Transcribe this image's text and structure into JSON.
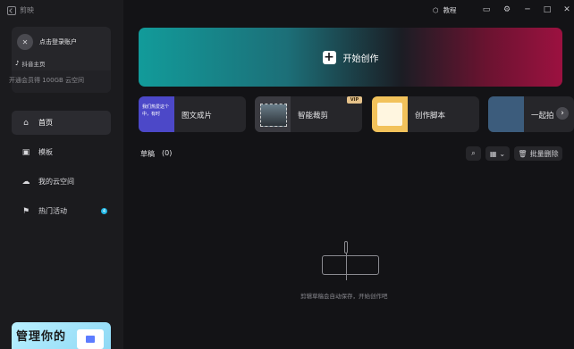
{
  "app": {
    "name": "剪映"
  },
  "account": {
    "avatar_glyph": "✕",
    "login_prompt": "点击登录账户",
    "douyin_label": "抖音主页",
    "member_promo": "开通会员得 100GB 云空间"
  },
  "nav": [
    {
      "label": "首页",
      "icon": "home-icon",
      "active": true
    },
    {
      "label": "模板",
      "icon": "template-icon",
      "active": false
    },
    {
      "label": "我的云空间",
      "icon": "cloud-icon",
      "active": false
    },
    {
      "label": "热门活动",
      "icon": "flag-icon",
      "active": false,
      "badge": "4"
    }
  ],
  "promo": {
    "text": "管理你的"
  },
  "topbar": {
    "tutorial": "教程",
    "icons": [
      "tutorial-icon",
      "feedback-icon",
      "settings-icon",
      "minimize-icon",
      "maximize-icon",
      "close-icon"
    ]
  },
  "create": {
    "label": "开始创作",
    "plus": "+"
  },
  "tools": [
    {
      "label": "图文成片",
      "thumb_text": "我们热爱这个\n中，有时"
    },
    {
      "label": "智能裁剪",
      "vip": "VIP"
    },
    {
      "label": "创作脚本"
    },
    {
      "label": "一起拍"
    }
  ],
  "drafts": {
    "title": "草稿",
    "count": "(0)",
    "delete_label": "批量删除"
  },
  "empty": {
    "message": "剪辑草稿会自动保存，开始创作吧"
  },
  "colors": {
    "accent_teal": "#129b9a",
    "accent_red": "#9c1140",
    "badge_blue": "#22b8e6"
  }
}
